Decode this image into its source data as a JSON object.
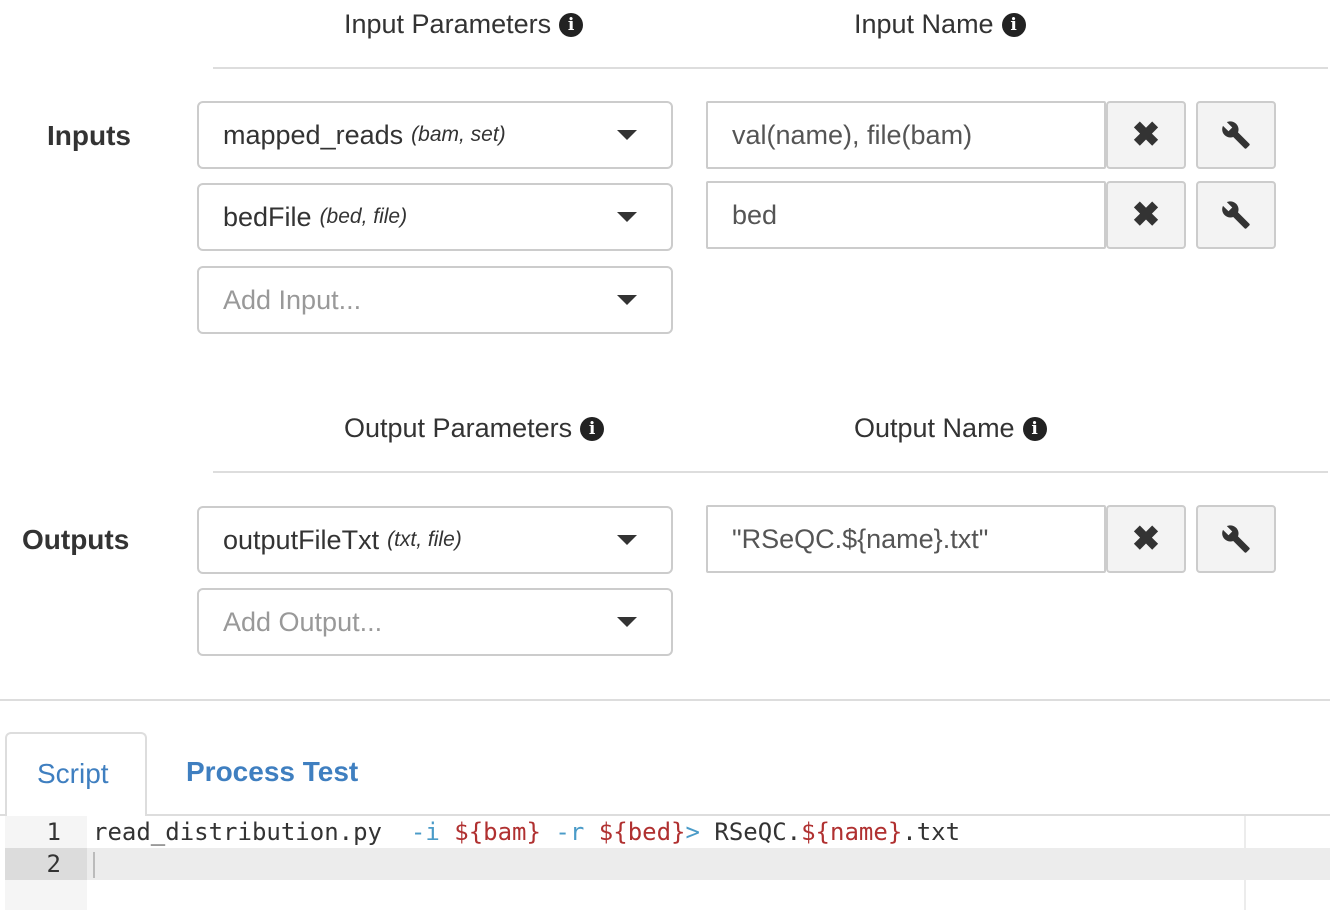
{
  "inputs_section": {
    "label": "Inputs",
    "params_header": "Input Parameters",
    "name_header": "Input Name",
    "rows": [
      {
        "param": "mapped_reads",
        "type": "(bam, set)",
        "name_value": "val(name), file(bam)"
      },
      {
        "param": "bedFile",
        "type": "(bed, file)",
        "name_value": "bed"
      }
    ],
    "add_placeholder": "Add Input..."
  },
  "outputs_section": {
    "label": "Outputs",
    "params_header": "Output Parameters",
    "name_header": "Output Name",
    "rows": [
      {
        "param": "outputFileTxt",
        "type": "(txt, file)",
        "name_value": "\"RSeQC.${name}.txt\""
      }
    ],
    "add_placeholder": "Add Output..."
  },
  "icons": {
    "info": "info-circle-icon",
    "remove": "times-icon",
    "settings": "wrench-icon",
    "dropdown": "caret-down-icon"
  },
  "tabs": [
    {
      "label": "Script",
      "active": true
    },
    {
      "label": "Process Test",
      "active": false
    }
  ],
  "editor": {
    "lines": [
      {
        "number": "1",
        "text": "read_distribution.py  -i ${bam} -r ${bed}> RSeQC.${name}.txt"
      },
      {
        "number": "2",
        "text": ""
      }
    ]
  },
  "colors": {
    "accent": "#3f7fc0",
    "border": "#cccccc",
    "rule": "#dddddd",
    "token_variable": "#b03030",
    "token_operator": "#4a9bc8"
  }
}
